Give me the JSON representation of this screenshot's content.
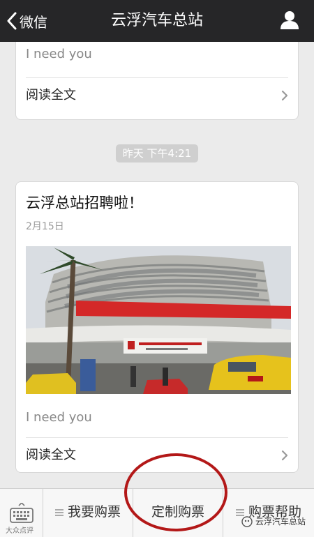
{
  "navbar": {
    "back_label": "微信",
    "title": "云浮汽车总站"
  },
  "messages": [
    {
      "summary": "I need you",
      "read_more": "阅读全文"
    }
  ],
  "timestamp": "昨天 下午4:21",
  "article": {
    "title": "云浮总站招聘啦！",
    "date": "2月15日",
    "summary": "I need you",
    "read_more": "阅读全文"
  },
  "menu": {
    "items": [
      {
        "label": "我要购票"
      },
      {
        "label": "定制购票"
      },
      {
        "label": "购票帮助"
      }
    ]
  },
  "watermark": {
    "left": "大众点评",
    "right": "云浮汽车总站"
  },
  "colors": {
    "navbar_bg": "#262628",
    "highlight_circle": "#b31818",
    "background": "#ebebeb"
  }
}
